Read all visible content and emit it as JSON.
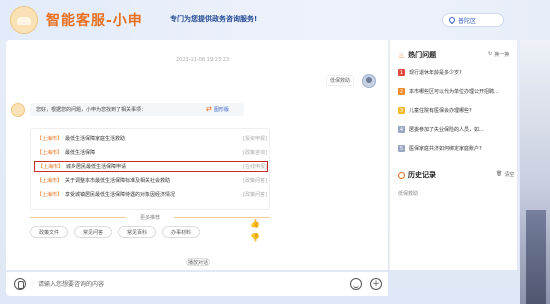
{
  "header": {
    "title": "智能客服-小申",
    "subtitle": "专门为您提供政务咨询服务!",
    "location": "普陀区"
  },
  "chat": {
    "timestamp": "2023-11-08 19:23:23",
    "user_message": "低保救助",
    "bot_message": "您好，根据您的问题，小申为您找到了相关事项：",
    "toggle_label": "图形版",
    "results": [
      {
        "tag": "【上海市】",
        "text": "最低生活保障家庭生活救助",
        "meta": "[投资申报]"
      },
      {
        "tag": "【上海市】",
        "text": "最低生活保障",
        "meta": "[政策咨询]"
      },
      {
        "tag": "【上海市】",
        "text": "城乡居民最低生活保障申请",
        "meta": "[在线申报]"
      },
      {
        "tag": "【上海市】",
        "text": "关于调整本市最低生活保障标准及相关社会救助",
        "meta": "[政策问答]"
      },
      {
        "tag": "【上海市】",
        "text": "享受城镇居民最低生活保障待遇的对象因经济情况",
        "meta": "[政策问答]"
      }
    ],
    "more_label": "更多推荐",
    "chips": [
      "政策文件",
      "常见问答",
      "常见百科",
      "办事材料"
    ],
    "transfer_label": "播放对话"
  },
  "sidebar": {
    "hot_title": "热门问题",
    "refresh_label": "换一换",
    "hot_items": [
      {
        "num": "1",
        "text": "现行退休年龄是多少岁?",
        "color": "#e5483f"
      },
      {
        "num": "2",
        "text": "本市哪些区可以代为单位办理公开招聘...",
        "color": "#f08a2b"
      },
      {
        "num": "3",
        "text": "儿童住院有医保会办理哪些?",
        "color": "#f5b82e"
      },
      {
        "num": "4",
        "text": "居委参加了失业保险的人员，如...",
        "color": "#9aa7c2"
      },
      {
        "num": "5",
        "text": "医保家庭共济如何绑定家庭账户?",
        "color": "#9aa7c2"
      }
    ],
    "history_title": "历史记录",
    "clear_label": "清空",
    "history_items": [
      "低保救助"
    ]
  },
  "input": {
    "placeholder": "请输入您想要咨询的内容"
  }
}
